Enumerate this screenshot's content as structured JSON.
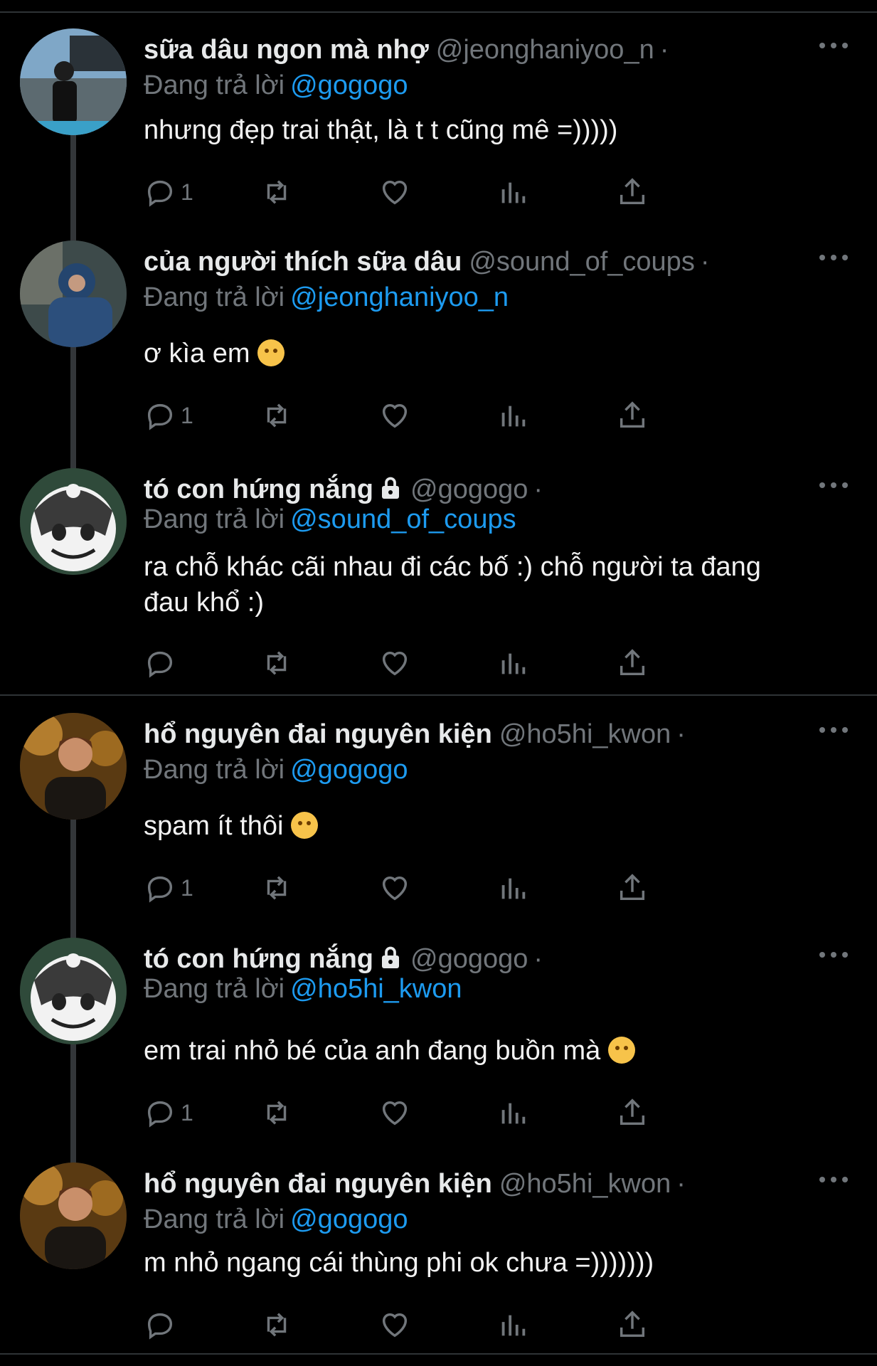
{
  "reply_prefix": "Đang trả lời",
  "dot": "·",
  "tweets": [
    {
      "name": "sữa dâu ngon mà nhợ",
      "handle": "@jeonghaniyoo_n",
      "reply_to": "@gogogo",
      "text": "nhưng đẹp trai thật, là t t cũng mê =)))))",
      "reply_count": "1",
      "avatar_icon": "user-avatar-icon"
    },
    {
      "name": "của người thích sữa dâu",
      "handle": "@sound_of_coups",
      "reply_to": "@jeonghaniyoo_n",
      "text": "ơ kìa em",
      "reply_count": "1",
      "avatar_icon": "user-avatar-icon"
    },
    {
      "name": "tó con hứng nắng",
      "handle": "@gogogo",
      "reply_to": "@sound_of_coups",
      "text_line1": "ra chỗ khác cãi nhau đi các bố :) chỗ người ta đang",
      "text_line2": "đau khổ :)",
      "reply_count": "",
      "locked": true,
      "avatar_icon": "cartoon-avatar-icon"
    },
    {
      "name": "hổ nguyên đai nguyên kiện",
      "handle": "@ho5hi_kwon",
      "reply_to": "@gogogo",
      "text": "spam ít thôi",
      "reply_count": "1",
      "avatar_icon": "user-avatar-icon"
    },
    {
      "name": "tó con hứng nắng",
      "handle": "@gogogo",
      "reply_to": "@ho5hi_kwon",
      "text": "em trai nhỏ bé của anh đang buồn mà",
      "reply_count": "1",
      "locked": true,
      "avatar_icon": "cartoon-avatar-icon"
    },
    {
      "name": "hổ nguyên đai nguyên kiện",
      "handle": "@ho5hi_kwon",
      "reply_to": "@gogogo",
      "text": "m nhỏ ngang cái thùng phi ok chưa =)))))))",
      "reply_count": "",
      "avatar_icon": "user-avatar-icon"
    }
  ],
  "colors": {
    "background": "#000000",
    "text": "#e7e9ea",
    "muted": "#71767b",
    "link": "#1d9bf0"
  }
}
